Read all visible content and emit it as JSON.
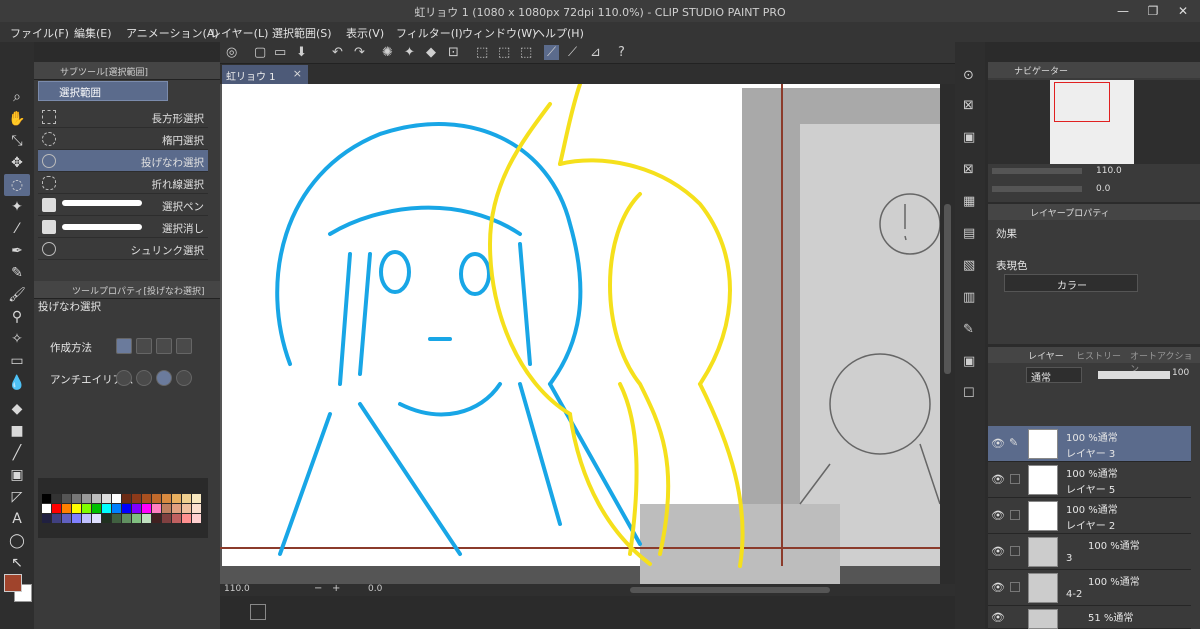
{
  "window": {
    "title": "虹リョウ 1 (1080 x 1080px 72dpi 110.0%) - CLIP STUDIO PAINT PRO",
    "minimize": "—",
    "maximize": "❐",
    "close": "✕"
  },
  "menu": [
    "ファイル(F)",
    "編集(E)",
    "アニメーション(A)",
    "レイヤー(L)",
    "選択範囲(S)",
    "表示(V)",
    "フィルター(I)",
    "ウィンドウ(W)",
    "ヘルプ(H)"
  ],
  "subtool": {
    "header": "サブツール[選択範囲]",
    "group": "選択範囲",
    "items": [
      "長方形選択",
      "楕円選択",
      "投げなわ選択",
      "折れ線選択",
      "選択ペン",
      "選択消し",
      "シュリンク選択"
    ],
    "selected_index": 2
  },
  "tool_property": {
    "header": "ツールプロパティ[投げなわ選択]",
    "title": "投げなわ選択",
    "rows": [
      {
        "label": "作成方法"
      },
      {
        "label": "アンチエイリアス"
      }
    ]
  },
  "palette_colors": [
    "#000000",
    "#333333",
    "#555555",
    "#777777",
    "#999999",
    "#bbbbbb",
    "#dddddd",
    "#ffffff",
    "#6b2b15",
    "#8c3a1a",
    "#a85020",
    "#c06a2c",
    "#d88a40",
    "#e8b060",
    "#f0d090",
    "#f8e8c0",
    "#ffffff",
    "#ff0000",
    "#ff8000",
    "#ffff00",
    "#80ff00",
    "#00c000",
    "#00ffff",
    "#0080ff",
    "#0000ff",
    "#8000ff",
    "#ff00ff",
    "#ff80c0",
    "#c08060",
    "#e0a080",
    "#f0c0a0",
    "#fbe0d0",
    "#202040",
    "#404080",
    "#6060c0",
    "#8080ff",
    "#c0c0ff",
    "#e0e0ff",
    "#203020",
    "#406040",
    "#609060",
    "#80c080",
    "#c0e0c0",
    "#402020",
    "#804040",
    "#c06060",
    "#ff9090",
    "#ffd0d0"
  ],
  "colors": {
    "main": "#a0442c",
    "sub": "#ffffff"
  },
  "canvas_tab": {
    "label": "虹リョウ 1",
    "close": "×"
  },
  "status": {
    "zoom": "110.0",
    "angle": "0.0"
  },
  "navigator": {
    "tab": "ナビゲーター",
    "zoom": "110.0",
    "angle": "0.0"
  },
  "layer_property": {
    "tab": "レイヤープロパティ",
    "effect_label": "効果",
    "expression_label": "表現色",
    "expression_value": "カラー"
  },
  "layer_panel": {
    "tabs": [
      "レイヤー",
      "ヒストリー",
      "オートアクション"
    ],
    "blend": "通常",
    "opacity": "100",
    "layers": [
      {
        "l1": "100 %通常",
        "l2": "レイヤー 3",
        "selected": true
      },
      {
        "l1": "100 %通常",
        "l2": "レイヤー 5",
        "selected": false
      },
      {
        "l1": "100 %通常",
        "l2": "レイヤー 2",
        "selected": false
      },
      {
        "l1": "100 %通常",
        "l2": "3",
        "selected": false
      },
      {
        "l1": "100 %通常",
        "l2": "4-2",
        "selected": false
      },
      {
        "l1": "51 %通常",
        "l2": "",
        "selected": false
      }
    ]
  }
}
